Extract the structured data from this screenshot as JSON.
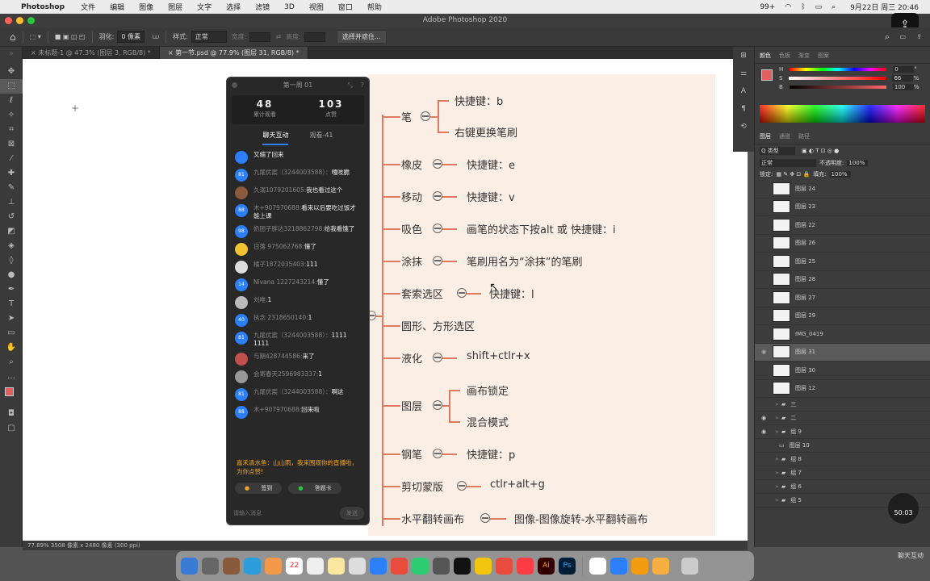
{
  "menubar": {
    "app_name": "Photoshop",
    "items": [
      "文件",
      "编辑",
      "图像",
      "图层",
      "文字",
      "选择",
      "滤镜",
      "3D",
      "视图",
      "窗口",
      "帮助"
    ],
    "notif_badge": "99+",
    "datetime": "9月22日 周三  20:46"
  },
  "window_title": "Adobe Photoshop 2020",
  "options": {
    "feather_label": "羽化:",
    "feather_value": "0 像素",
    "style_label": "样式:",
    "style_value": "正常",
    "width_label": "宽度:",
    "height_label": "高度:",
    "select_button": "选择并遮住..."
  },
  "doc_tabs": [
    "未标题-1 @ 47.3% (图层 3, RGB/8) *",
    "第一节.psd @ 77.9% (图层 31, RGB/8) *"
  ],
  "statusbar": "77.89%    3508 像素 x 2480 像素 (300 ppi)",
  "chat": {
    "title": "第一周 01",
    "viewers_value": "48",
    "viewers_label": "累计观看",
    "likes_value": "103",
    "likes_label": "点赞",
    "tab_chat": "聊天互动",
    "tab_watch": "观看-41",
    "messages": [
      {
        "name": "",
        "text": "又缩了回来",
        "avatar": "",
        "color": "#2d7ff9"
      },
      {
        "name": "九尾优宸（3244003588）：",
        "text": "嘎吱脆",
        "avatar": "81",
        "color": "#2d7ff9"
      },
      {
        "name": "久溺1079201605:",
        "text": "我也看过这个",
        "avatar": "",
        "color": "#8a5a3c"
      },
      {
        "name": "木+907970688:",
        "text": "看来以后要吃过饭才能上课",
        "avatar": "88",
        "color": "#2d7ff9"
      },
      {
        "name": "奶团子胖达3218862798:",
        "text": "给我看饿了",
        "avatar": "98",
        "color": "#2d7ff9"
      },
      {
        "name": "日落 975062768:",
        "text": "懂了",
        "avatar": "",
        "color": "#f1c232"
      },
      {
        "name": "橘子1872035403:",
        "text": "111",
        "avatar": "",
        "color": "#dddddd"
      },
      {
        "name": "Nivana 1227243214:",
        "text": "懂了",
        "avatar": "14",
        "color": "#2d7ff9"
      },
      {
        "name": "刘唯:",
        "text": "1",
        "avatar": "",
        "color": "#bbbbbb"
      },
      {
        "name": "执念 2318650140:",
        "text": "1",
        "avatar": "40",
        "color": "#2d7ff9"
      },
      {
        "name": "九尾优宸（3244003588）：",
        "text": "1111 1111",
        "avatar": "81",
        "color": "#2d7ff9"
      },
      {
        "name": "与期428744586:",
        "text": "来了",
        "avatar": "",
        "color": "#c0504d"
      },
      {
        "name": "会寄春天2596983337:",
        "text": "1",
        "avatar": "",
        "color": "#999999"
      },
      {
        "name": "九尾优宸（3244003588）：",
        "text": "啊这",
        "avatar": "81",
        "color": "#2d7ff9"
      },
      {
        "name": "木+907970688:",
        "text": "回来啦",
        "avatar": "88",
        "color": "#2d7ff9"
      }
    ],
    "gift_text": "嘉禾清水鱼：山山雨，我来围观你的直播啦，为你点赞!",
    "btn_checkin": "签到",
    "btn_answer": "答题卡",
    "input_placeholder": "请输入消息",
    "send_label": "发送"
  },
  "mindmap": {
    "items": [
      {
        "label": "笔",
        "subs": [
          "快捷键：b",
          "右键更换笔刷"
        ]
      },
      {
        "label": "橡皮",
        "subs": [
          "快捷键：e"
        ]
      },
      {
        "label": "移动",
        "subs": [
          "快捷键：v"
        ]
      },
      {
        "label": "吸色",
        "subs": [
          "画笔的状态下按alt  或 快捷键：i"
        ]
      },
      {
        "label": "涂抹",
        "subs": [
          "笔刷用名为“涂抹”的笔刷"
        ]
      },
      {
        "label": "套索选区",
        "subs": [
          "快捷键：l"
        ]
      },
      {
        "label": "圆形、方形选区",
        "subs": []
      },
      {
        "label": "液化",
        "subs": [
          "shift+ctlr+x"
        ]
      },
      {
        "label": "图层",
        "subs": [
          "画布锁定",
          "混合模式"
        ]
      },
      {
        "label": "钢笔",
        "subs": [
          "快捷键：p"
        ]
      },
      {
        "label": "剪切蒙版",
        "subs": [
          "ctlr+alt+g"
        ]
      },
      {
        "label": "水平翻转画布",
        "subs": [
          "图像-图像旋转-水平翻转画布"
        ]
      }
    ]
  },
  "panels": {
    "color_tabs": [
      "颜色",
      "色板",
      "渐变",
      "图案"
    ],
    "h_label": "H",
    "h_value": "0",
    "s_label": "S",
    "s_value": "66",
    "b_label": "B",
    "b_value": "100",
    "pct": "%",
    "deg": "°",
    "layer_tabs": [
      "图层",
      "通道",
      "路径"
    ],
    "filter_label": "Q 类型",
    "blend_mode": "正常",
    "opacity_label": "不透明度:",
    "opacity_value": "100%",
    "lock_label": "锁定:",
    "fill_label": "填充:",
    "fill_value": "100%",
    "layers": [
      "图层 24",
      "图层 23",
      "图层 22",
      "图层 26",
      "图层 25",
      "图层 28",
      "图层 27",
      "图层 29",
      "IMG_0419",
      "图层 31",
      "图层 30",
      "图层 12"
    ],
    "selected_layer": "图层 31",
    "groups": [
      "三",
      "二",
      "组 9",
      "图层 10",
      "组 8",
      "组 7",
      "组 6",
      "组 5"
    ]
  },
  "timer": "50:03",
  "watermark": "聊天互动",
  "colors": {
    "accent_orange": "#e07a5f",
    "mindmap_bg": "#fbeee4",
    "foreground_swatch": "#e06060",
    "link_blue": "#2d7ff9"
  }
}
